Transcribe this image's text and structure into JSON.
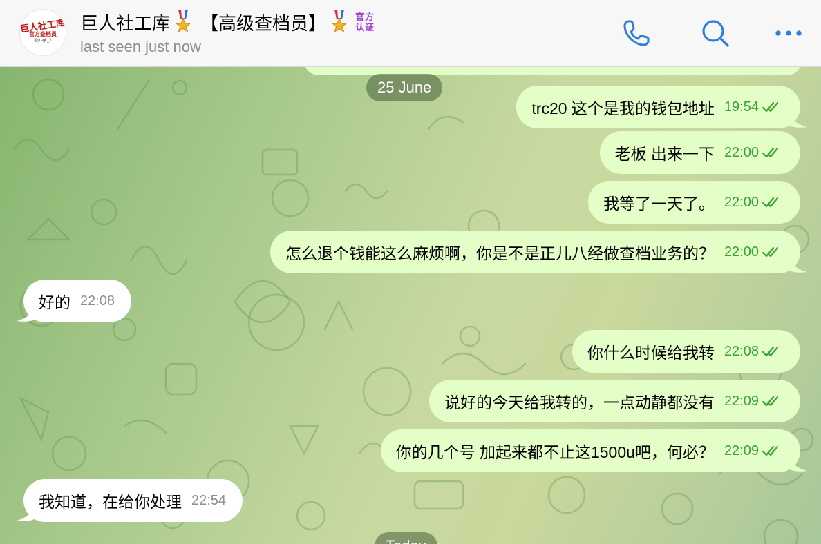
{
  "header": {
    "avatar": {
      "line1": "巨人社工库",
      "line2": "官方查档员",
      "line3": "@jrsgk_1"
    },
    "title": "巨人社工库",
    "badge": "【高级查档员】",
    "official_label": [
      "官方",
      "认证"
    ],
    "status": "last seen just now",
    "icons": [
      "phone-icon",
      "search-icon",
      "more-icon"
    ]
  },
  "chat": {
    "date_label": "25 June",
    "bottom_label": "Today",
    "messages": [
      {
        "dir": "out",
        "text": "trc20 这个是我的钱包地址",
        "time": "19:54"
      },
      {
        "dir": "out",
        "text": "老板 出来一下",
        "time": "22:00"
      },
      {
        "dir": "out",
        "text": "我等了一天了。",
        "time": "22:00"
      },
      {
        "dir": "out",
        "text": "怎么退个钱能这么麻烦啊，你是不是正儿八经做查档业务的？",
        "time": "22:00"
      },
      {
        "dir": "in",
        "text": "好的",
        "time": "22:08"
      },
      {
        "dir": "out",
        "text": "你什么时候给我转",
        "time": "22:08"
      },
      {
        "dir": "out",
        "text": "说好的今天给我转的，一点动静都没有",
        "time": "22:09"
      },
      {
        "dir": "out",
        "text": "你的几个号 加起来都不止这1500u吧，何必？",
        "time": "22:09"
      },
      {
        "dir": "in",
        "text": "我知道，在给你处理",
        "time": "22:54"
      }
    ]
  },
  "colors": {
    "outgoing_bubble": "#e3fec6",
    "incoming_bubble": "#ffffff",
    "accent": "#2f7fd6",
    "time_out": "#3aa235",
    "official_badge": "#a03fd0"
  }
}
